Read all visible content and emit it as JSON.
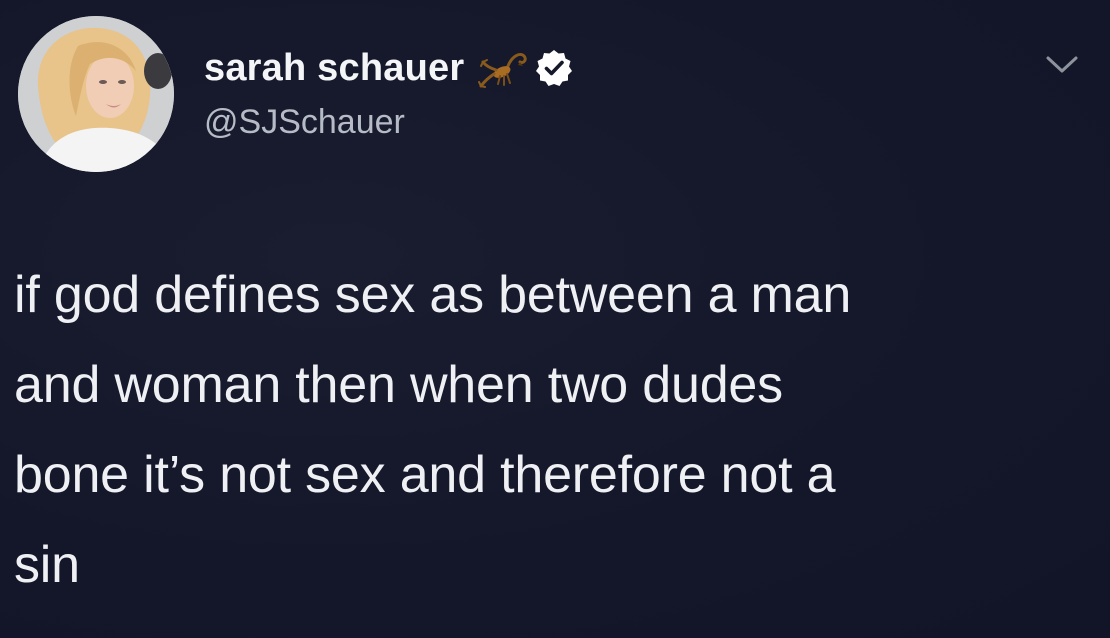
{
  "author": {
    "display_name": "sarah schauer",
    "handle": "@SJSchauer",
    "emoji": "scorpion-icon",
    "verified": true
  },
  "tweet": {
    "lines": [
      "if god defines sex as between a man",
      "and woman then when two dudes",
      "bone it’s not sex and therefore not a",
      "sin"
    ]
  },
  "colors": {
    "background": "#15172a",
    "text": "#eef0f3",
    "handle": "#b6bcc6",
    "verified_badge": "#ffffff"
  }
}
